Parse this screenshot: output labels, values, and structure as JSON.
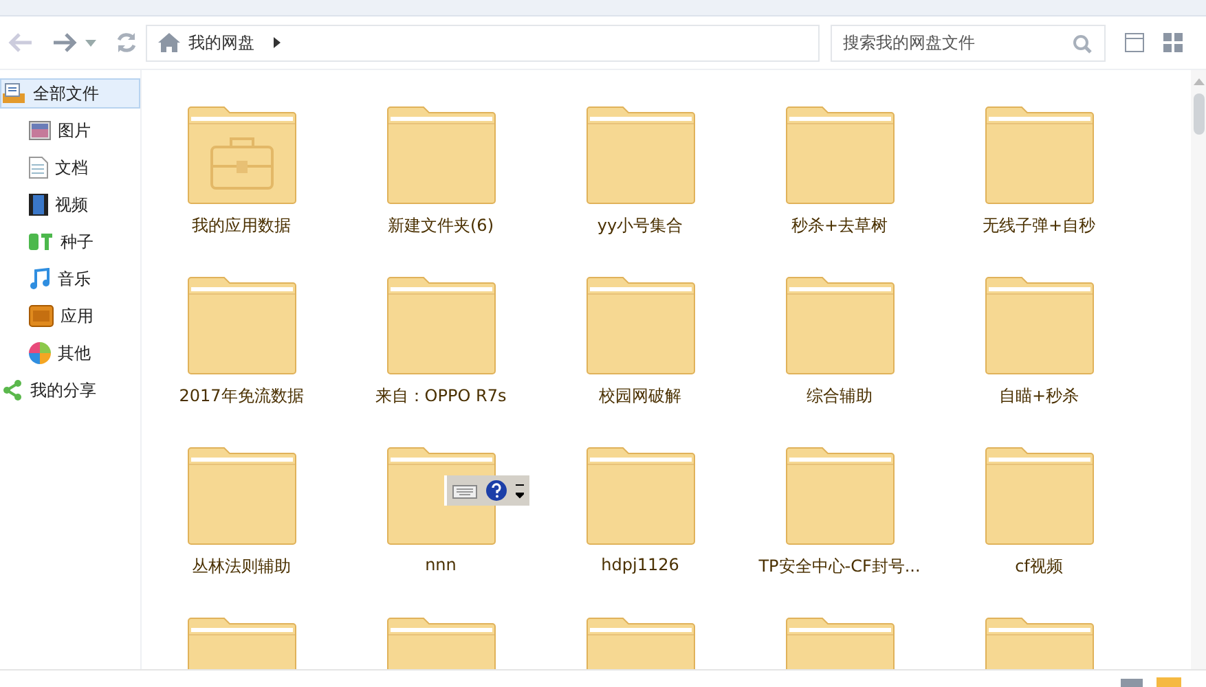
{
  "toolbar": {
    "breadcrumb": "我的网盘",
    "search": {
      "placeholder": "搜索我的网盘文件"
    }
  },
  "sidebar": {
    "items": [
      {
        "label": "全部文件",
        "kind": "all",
        "selected": true,
        "children": [
          {
            "label": "图片",
            "kind": "image",
            "selected": false
          },
          {
            "label": "文档",
            "kind": "doc",
            "selected": false
          },
          {
            "label": "视频",
            "kind": "video",
            "selected": false
          },
          {
            "label": "种子",
            "kind": "bt",
            "selected": false
          },
          {
            "label": "音乐",
            "kind": "music",
            "selected": false
          },
          {
            "label": "应用",
            "kind": "app",
            "selected": false
          },
          {
            "label": "其他",
            "kind": "other",
            "selected": false
          }
        ]
      },
      {
        "label": "我的分享",
        "kind": "share",
        "selected": false
      }
    ]
  },
  "folders": [
    {
      "name": "我的应用数据",
      "kind": "app"
    },
    {
      "name": "新建文件夹(6)",
      "kind": "plain"
    },
    {
      "name": "yy小号集合",
      "kind": "plain"
    },
    {
      "name": "秒杀+去草树",
      "kind": "plain"
    },
    {
      "name": "无线子弹+自秒",
      "kind": "plain"
    },
    {
      "name": "2017年免流数据",
      "kind": "plain"
    },
    {
      "name": "来自：OPPO R7s",
      "kind": "plain"
    },
    {
      "name": "校园网破解",
      "kind": "plain"
    },
    {
      "name": "综合辅助",
      "kind": "plain"
    },
    {
      "name": "自瞄+秒杀",
      "kind": "plain"
    },
    {
      "name": "丛林法则辅助",
      "kind": "plain"
    },
    {
      "name": "nnn",
      "kind": "plain"
    },
    {
      "name": "hdpj1126",
      "kind": "plain"
    },
    {
      "name": "TP安全中心-CF封号...",
      "kind": "plain"
    },
    {
      "name": "cf视频",
      "kind": "plain"
    },
    {
      "kind": "plain"
    },
    {
      "kind": "plain"
    },
    {
      "kind": "plain"
    },
    {
      "kind": "plain"
    },
    {
      "kind": "plain"
    }
  ]
}
